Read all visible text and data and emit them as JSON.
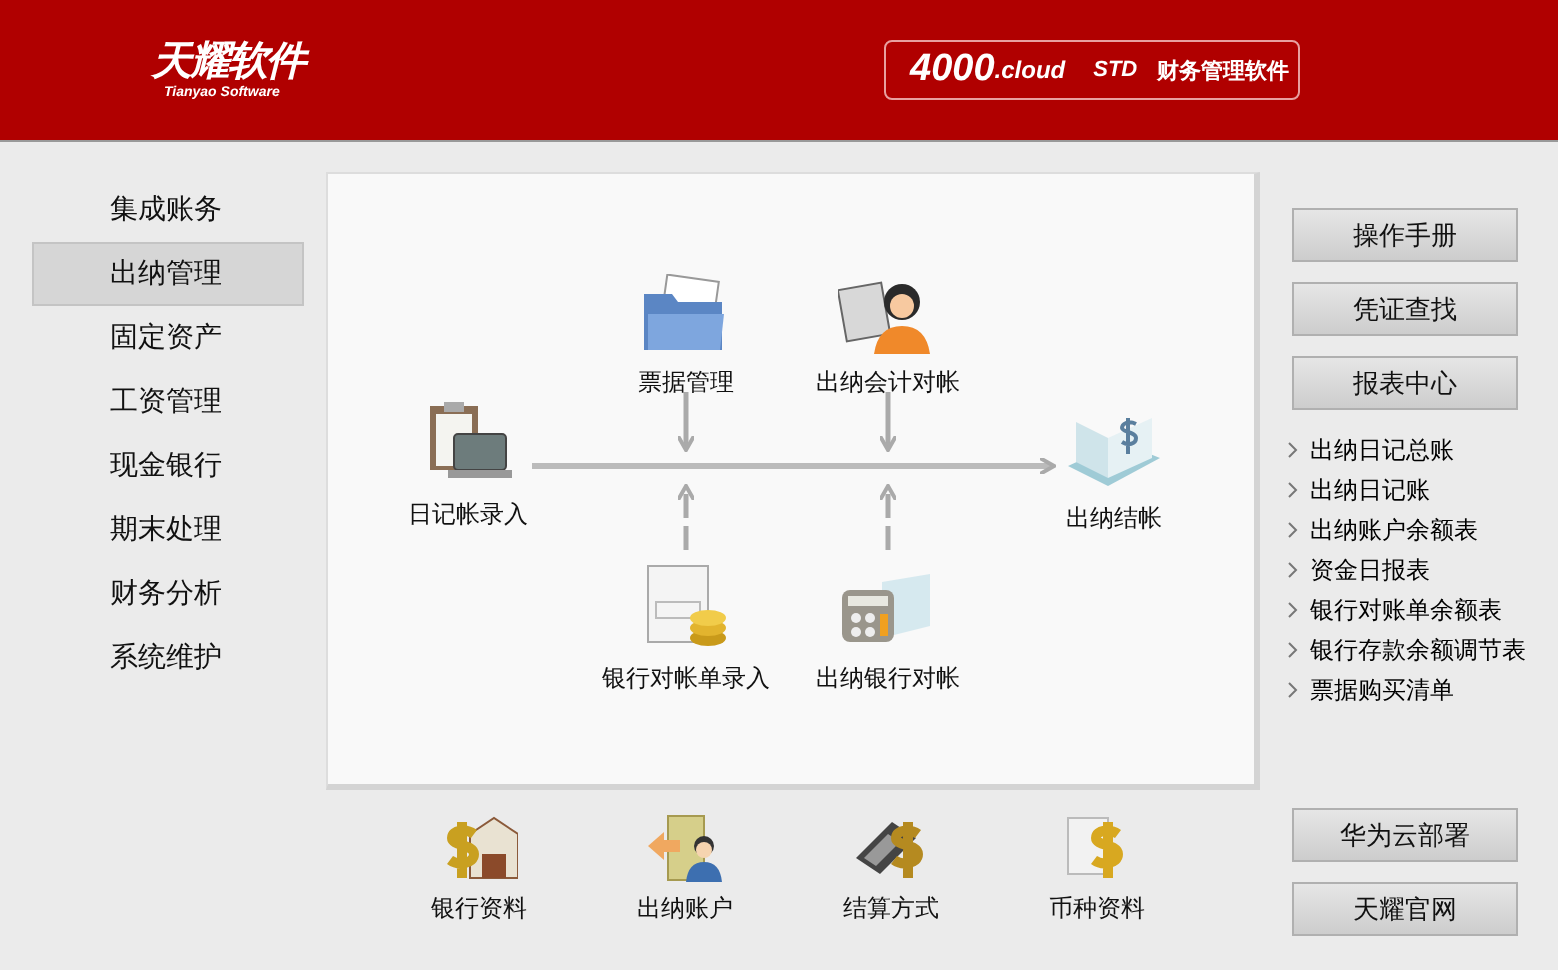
{
  "header": {
    "logo": "天耀软件",
    "logo_sub": "Tianyao Software",
    "product_number": "4000",
    "product_suffix": ".cloud",
    "edition": "STD",
    "product_name": "财务管理软件"
  },
  "nav": [
    {
      "label": "集成账务",
      "selected": false
    },
    {
      "label": "出纳管理",
      "selected": true
    },
    {
      "label": "固定资产",
      "selected": false
    },
    {
      "label": "工资管理",
      "selected": false
    },
    {
      "label": "现金银行",
      "selected": false
    },
    {
      "label": "期末处理",
      "selected": false
    },
    {
      "label": "财务分析",
      "selected": false
    },
    {
      "label": "系统维护",
      "selected": false
    }
  ],
  "flow": {
    "nodes": [
      {
        "label": "日记帐录入",
        "kind": "clipboard"
      },
      {
        "label": "票据管理",
        "kind": "folder"
      },
      {
        "label": "出纳会计对帐",
        "kind": "accountant"
      },
      {
        "label": "出纳结帐",
        "kind": "ledger"
      },
      {
        "label": "银行对帐单录入",
        "kind": "statement"
      },
      {
        "label": "出纳银行对帐",
        "kind": "calculator"
      }
    ]
  },
  "shortcuts": [
    {
      "label": "银行资料",
      "kind": "bank"
    },
    {
      "label": "出纳账户",
      "kind": "account"
    },
    {
      "label": "结算方式",
      "kind": "terminal"
    },
    {
      "label": "币种资料",
      "kind": "currency"
    }
  ],
  "side": {
    "top_buttons": [
      "操作手册",
      "凭证查找",
      "报表中心"
    ],
    "reports": [
      "出纳日记总账",
      "出纳日记账",
      "出纳账户余额表",
      "资金日报表",
      "银行对账单余额表",
      "银行存款余额调节表",
      "票据购买清单"
    ],
    "bottom_buttons": [
      "华为云部署",
      "天耀官网"
    ]
  }
}
